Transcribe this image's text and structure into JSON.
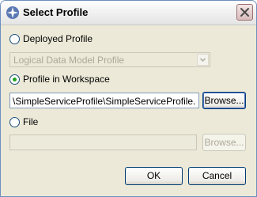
{
  "window": {
    "title": "Select Profile"
  },
  "options": {
    "deployed": {
      "label": "Deployed Profile",
      "checked": false
    },
    "combo": {
      "value": "Logical Data Model Profile"
    },
    "workspace": {
      "label": "Profile in Workspace",
      "checked": true,
      "path": "\\SimpleServiceProfile\\SimpleServiceProfile.epx",
      "browse_label": "Browse..."
    },
    "file": {
      "label": "File",
      "checked": false,
      "path": "",
      "browse_label": "Browse..."
    }
  },
  "buttons": {
    "ok": "OK",
    "cancel": "Cancel"
  },
  "icons": {
    "app": "eclipse-sparkle-icon",
    "close": "close-icon",
    "dropdown": "chevron-down-icon"
  }
}
